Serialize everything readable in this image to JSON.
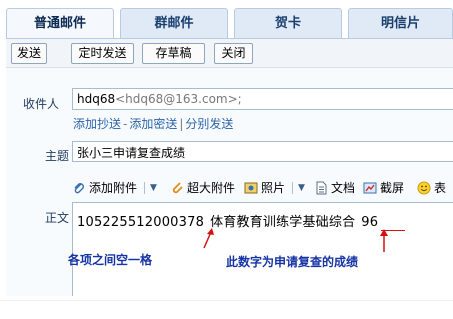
{
  "tabs": [
    {
      "label": "普通邮件",
      "active": true
    },
    {
      "label": "群邮件",
      "active": false
    },
    {
      "label": "贺卡",
      "active": false
    },
    {
      "label": "明信片",
      "active": false
    }
  ],
  "toolbar": {
    "send": "发送",
    "scheduled_send": "定时发送",
    "save_draft": "存草稿",
    "close": "关闭"
  },
  "recipient": {
    "label": "收件人",
    "name": "hdq68",
    "address": "<hdq68@163.com>;",
    "add_cc": "添加抄送",
    "add_bcc": "添加密送",
    "separate_send": "分别发送",
    "link_dash": "-",
    "link_bar": "|"
  },
  "subject": {
    "label": "主题",
    "value": "张小三申请复查成绩"
  },
  "attach_bar": {
    "add_attachment": "添加附件",
    "super_attachment": "超大附件",
    "photo": "照片",
    "document": "文档",
    "screenshot": "截屏",
    "emoticon": "表"
  },
  "body": {
    "label": "正文",
    "id_number": "105225512000378",
    "subject_name": "体育教育训练学基础综合",
    "score": "96"
  },
  "annotations": {
    "gap_note": "各项之间空一格",
    "score_note": "此数字为申请复查的成绩"
  },
  "colors": {
    "annotation_text": "#1634a5",
    "annotation_arrow": "#d11111",
    "tab_bg": "#dfeaf6",
    "link": "#2b64a8"
  }
}
